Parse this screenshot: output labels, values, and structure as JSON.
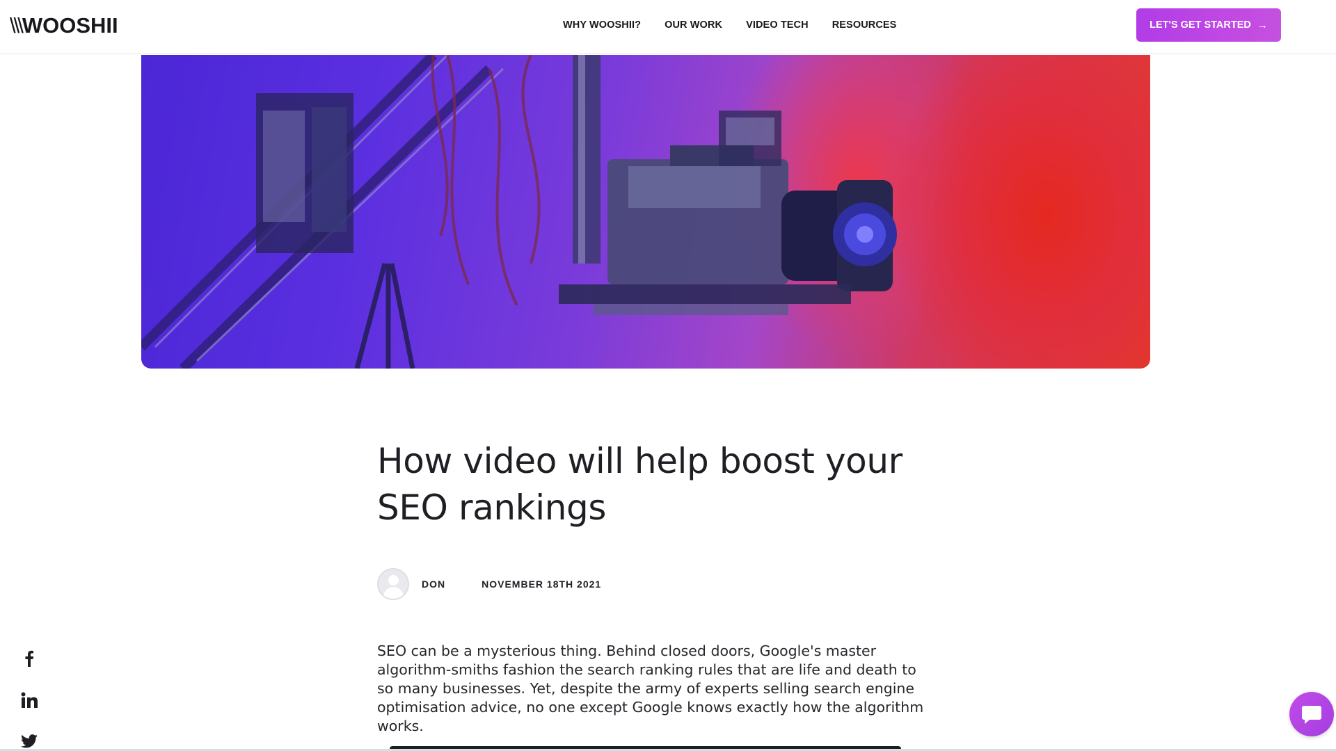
{
  "header": {
    "logo_slashes": "\\\\\\",
    "logo_text": "WOOSHII",
    "nav": [
      {
        "label": "WHY WOOSHII?"
      },
      {
        "label": "OUR WORK"
      },
      {
        "label": "VIDEO TECH"
      },
      {
        "label": "RESOURCES"
      }
    ],
    "cta_label": "LET'S GET STARTED",
    "cta_icon": "arrow-right-icon"
  },
  "hero": {
    "image": "studio-camera-crane-photo",
    "colors": {
      "left": "#4b27d6",
      "middle": "#a446c8",
      "right": "#e3362c"
    }
  },
  "article": {
    "title": "How video will help boost your SEO rankings",
    "author": "DON",
    "date": "NOVEMBER 18TH 2021",
    "intro": "SEO can be a mysterious thing. Behind closed doors, Google's master algorithm-smiths fashion the search ranking rules that are life and death to so many businesses. Yet, despite the army of experts selling search engine optimisation advice, no one except Google knows exactly how the algorithm works."
  },
  "social": [
    {
      "name": "facebook-icon"
    },
    {
      "name": "linkedin-icon"
    },
    {
      "name": "twitter-icon"
    }
  ],
  "chat": {
    "icon": "chat-bubble-icon",
    "color": "#b845e6"
  },
  "colors": {
    "accent": "#b23ce6",
    "text": "#1e1e24"
  }
}
